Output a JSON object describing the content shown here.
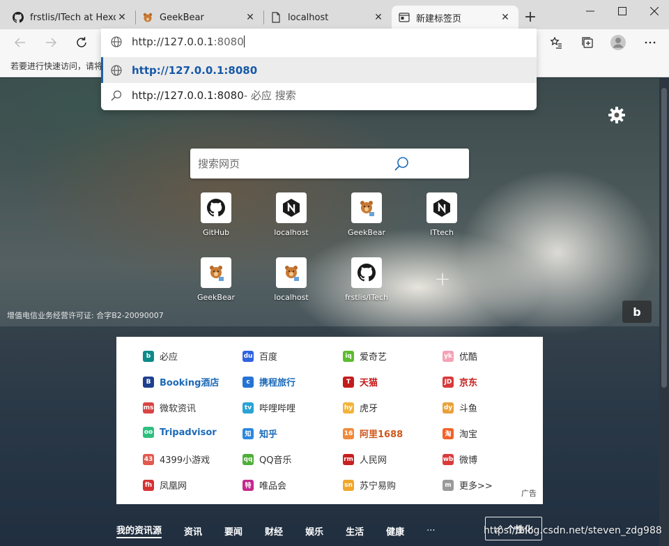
{
  "tabs": [
    {
      "title": "frstlis/ITech at Hexo",
      "icon": "github-icon"
    },
    {
      "title": "GeekBear",
      "icon": "bear-icon"
    },
    {
      "title": "localhost",
      "icon": "page-icon"
    },
    {
      "title": "新建标签页",
      "icon": "newtab-icon",
      "active": true
    }
  ],
  "favorites_bar": {
    "hint": "若要进行快速访问，请将"
  },
  "omnibox": {
    "typed_black": "http://127.0.0.1",
    "typed_gray": ":8080",
    "suggestions": [
      {
        "text": "http://127.0.0.1:8080",
        "suffix": "",
        "icon": "globe-icon",
        "selected": true
      },
      {
        "text": "http://127.0.0.1:8080",
        "suffix": " - 必应 搜索",
        "icon": "search-icon",
        "selected": false
      }
    ]
  },
  "search": {
    "placeholder": "搜索网页"
  },
  "quick_links": [
    {
      "label": "GitHub",
      "icon": "github-icon"
    },
    {
      "label": "localhost",
      "icon": "nginx-icon"
    },
    {
      "label": "GeekBear",
      "icon": "bear-icon"
    },
    {
      "label": "ITtech",
      "icon": "nginx-icon"
    },
    {
      "label": "GeekBear",
      "icon": "bear-icon"
    },
    {
      "label": "localhost",
      "icon": "bear-icon"
    },
    {
      "label": "frstlis/ITech",
      "icon": "github-icon"
    }
  ],
  "license_text": "增值电信业务经营许可证: 合字B2-20090007",
  "link_grid": [
    [
      {
        "text": "必应",
        "bold": false,
        "color": "#333333",
        "icon_bg": "#0e8a8a",
        "icon_char": "b"
      },
      {
        "text": "百度",
        "bold": false,
        "color": "#333333",
        "icon_bg": "#2f64e0",
        "icon_char": "du"
      },
      {
        "text": "爱奇艺",
        "bold": false,
        "color": "#333333",
        "icon_bg": "#5cbd2f",
        "icon_char": "iq"
      },
      {
        "text": "优酷",
        "bold": false,
        "color": "#333333",
        "icon_bg": "#f3a3b5",
        "icon_char": "yk"
      }
    ],
    [
      {
        "text": "Booking酒店",
        "bold": true,
        "color": "#1b6ab7",
        "icon_bg": "#1f3f8f",
        "icon_char": "B"
      },
      {
        "text": "携程旅行",
        "bold": true,
        "color": "#1b6ab7",
        "icon_bg": "#2673d4",
        "icon_char": "c"
      },
      {
        "text": "天猫",
        "bold": true,
        "color": "#c41b1b",
        "icon_bg": "#c41b1b",
        "icon_char": "T"
      },
      {
        "text": "京东",
        "bold": true,
        "color": "#c41b1b",
        "icon_bg": "#d83a3a",
        "icon_char": "JD"
      }
    ],
    [
      {
        "text": "微软资讯",
        "bold": false,
        "color": "#333333",
        "icon_bg": "#d94545",
        "icon_char": "ms"
      },
      {
        "text": "哔哩哔哩",
        "bold": false,
        "color": "#333333",
        "icon_bg": "#29a3d6",
        "icon_char": "tv"
      },
      {
        "text": "虎牙",
        "bold": false,
        "color": "#333333",
        "icon_bg": "#f2b33b",
        "icon_char": "hy"
      },
      {
        "text": "斗鱼",
        "bold": false,
        "color": "#333333",
        "icon_bg": "#e8a13b",
        "icon_char": "dy"
      }
    ],
    [
      {
        "text": "Tripadvisor",
        "bold": true,
        "color": "#1b6ab7",
        "icon_bg": "#2fbf7f",
        "icon_char": "oo"
      },
      {
        "text": "知乎",
        "bold": true,
        "color": "#1b6ab7",
        "icon_bg": "#2a88e0",
        "icon_char": "知"
      },
      {
        "text": "阿里1688",
        "bold": true,
        "color": "#d0561d",
        "icon_bg": "#f08a3b",
        "icon_char": "16"
      },
      {
        "text": "淘宝",
        "bold": false,
        "color": "#333333",
        "icon_bg": "#f2622a",
        "icon_char": "淘"
      }
    ],
    [
      {
        "text": "4399小游戏",
        "bold": false,
        "color": "#333333",
        "icon_bg": "#e25a4e",
        "icon_char": "43"
      },
      {
        "text": "QQ音乐",
        "bold": false,
        "color": "#333333",
        "icon_bg": "#4fae3a",
        "icon_char": "qq"
      },
      {
        "text": "人民网",
        "bold": false,
        "color": "#333333",
        "icon_bg": "#c62020",
        "icon_char": "rm"
      },
      {
        "text": "微博",
        "bold": false,
        "color": "#333333",
        "icon_bg": "#d93b3b",
        "icon_char": "wb"
      }
    ],
    [
      {
        "text": "凤凰网",
        "bold": false,
        "color": "#333333",
        "icon_bg": "#d63232",
        "icon_char": "fh"
      },
      {
        "text": "唯品会",
        "bold": false,
        "color": "#333333",
        "icon_bg": "#c3288c",
        "icon_char": "特"
      },
      {
        "text": "苏宁易购",
        "bold": false,
        "color": "#333333",
        "icon_bg": "#f2a72b",
        "icon_char": "sn"
      },
      {
        "text": "更多>>",
        "bold": false,
        "color": "#333333",
        "icon_bg": "#9a9a9a",
        "icon_char": "m"
      }
    ]
  ],
  "ad_label": "广告",
  "feed_nav": [
    "我的资讯源",
    "资讯",
    "要闻",
    "财经",
    "娱乐",
    "生活",
    "健康",
    "···"
  ],
  "personalize_label": "个性化",
  "watermark": "https://blog.csdn.net/steven_zdg988"
}
